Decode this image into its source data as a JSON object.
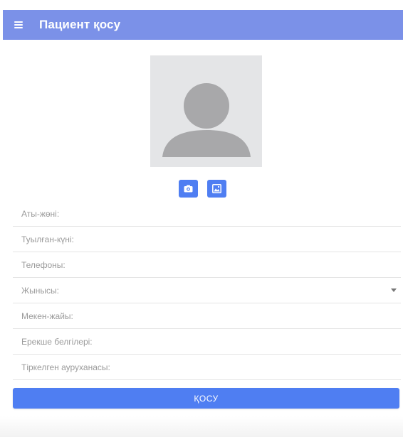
{
  "header": {
    "title": "Пациент қосу",
    "background": "#7b91e8"
  },
  "photo": {
    "placeholder": "user-avatar-icon",
    "buttons": [
      {
        "icon": "camera-icon"
      },
      {
        "icon": "gallery-icon"
      }
    ]
  },
  "form": {
    "fields": [
      {
        "label": "Аты-жөні:"
      },
      {
        "label": "Туылған-күні:"
      },
      {
        "label": "Телефоны:"
      },
      {
        "label": "Жынысы:",
        "type": "select"
      },
      {
        "label": "Мекен-жайы:"
      },
      {
        "label": "Ерекше белгілері:"
      },
      {
        "label": "Тіркелген ауруханасы:"
      }
    ],
    "submit_label": "ҚОСУ"
  },
  "colors": {
    "accent": "#4f7ef2",
    "header": "#7b91e8",
    "placeholder": "#e4e5e7"
  }
}
